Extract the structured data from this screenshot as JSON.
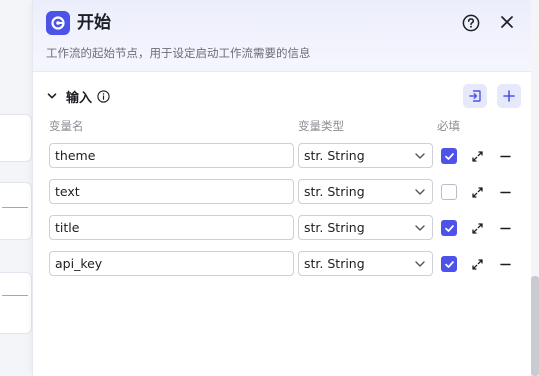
{
  "panel": {
    "title": "开始",
    "description": "工作流的起始节点，用于设定启动工作流需要的信息",
    "colors": {
      "accent": "#4d53e8",
      "header_bg": "#eceefc"
    }
  },
  "input_section": {
    "label": "输入",
    "columns": {
      "name": "变量名",
      "type": "变量类型",
      "required": "必填"
    },
    "rows": [
      {
        "name": "theme",
        "type": "str. String",
        "required": true
      },
      {
        "name": "text",
        "type": "str. String",
        "required": false
      },
      {
        "name": "title",
        "type": "str. String",
        "required": true
      },
      {
        "name": "api_key",
        "type": "str. String",
        "required": true
      }
    ]
  },
  "icons": {
    "node": "start-node-icon",
    "help": "help-circle-icon",
    "close": "close-icon",
    "collapse": "chevron-down-icon",
    "info": "info-icon",
    "import": "import-icon",
    "add": "plus-icon",
    "expand": "expand-icon",
    "remove": "minus-icon"
  }
}
